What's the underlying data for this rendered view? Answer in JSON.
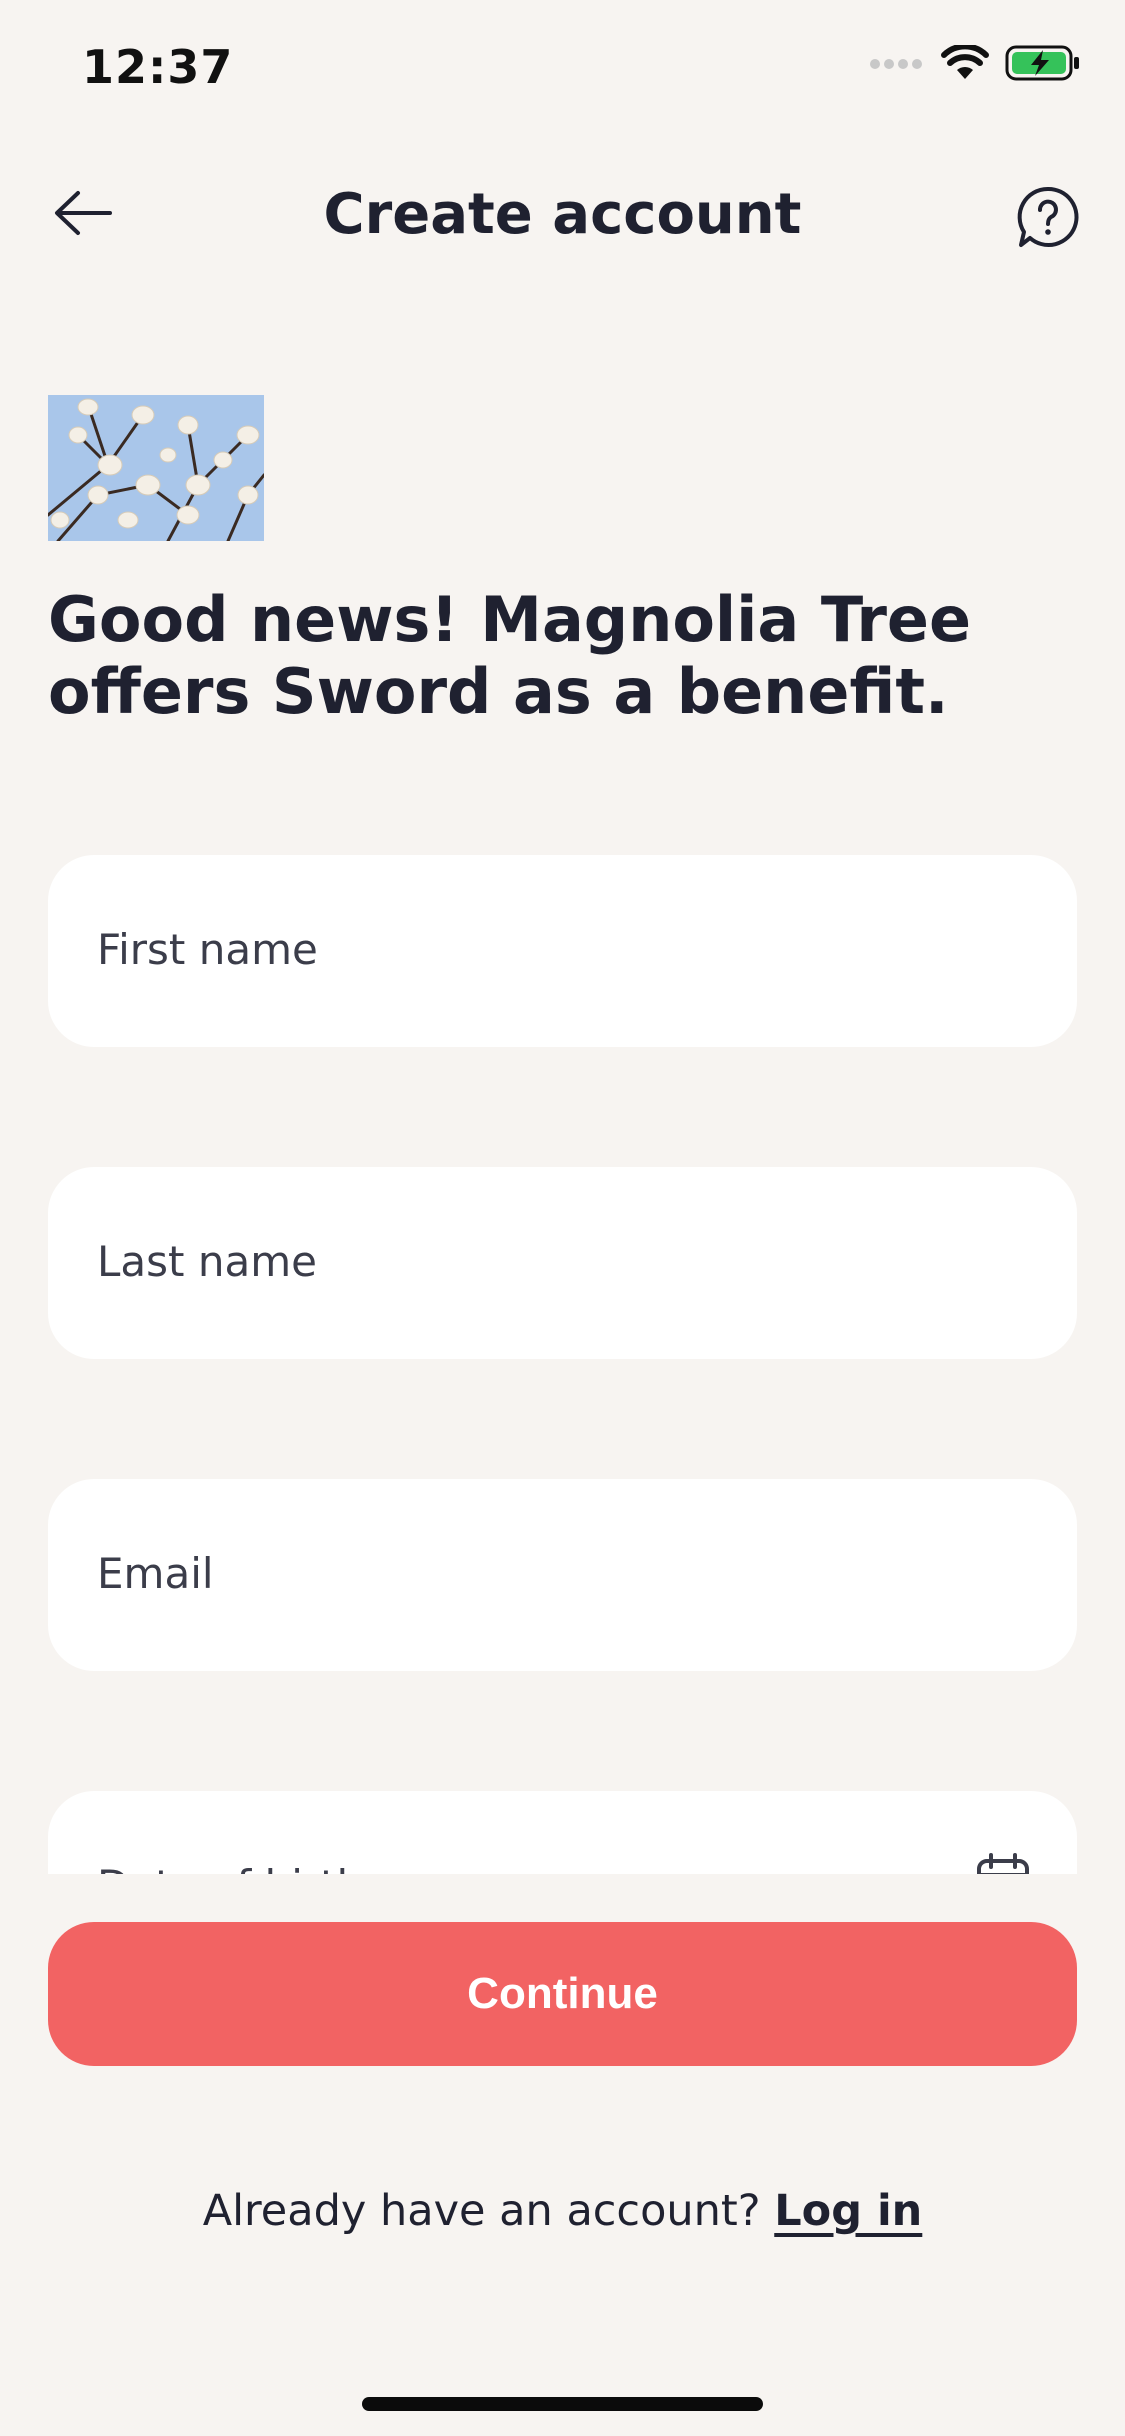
{
  "status_bar": {
    "time": "12:37",
    "icons": [
      "signal-dots-icon",
      "wifi-icon",
      "battery-charging-icon"
    ]
  },
  "header": {
    "title": "Create account",
    "back_icon": "arrow-left-icon",
    "help_icon": "question-bubble-icon"
  },
  "hero": {
    "image_name": "magnolia-tree-image",
    "headline": "Good news! Magnolia Tree offers Sword as a benefit."
  },
  "form": {
    "fields": [
      {
        "label": "First name"
      },
      {
        "label": "Last name"
      },
      {
        "label": "Email"
      },
      {
        "label": "Date of birth",
        "icon": "calendar-icon"
      }
    ]
  },
  "actions": {
    "continue_label": "Continue",
    "login_prompt": "Already have an account?",
    "login_link": "Log in"
  },
  "colors": {
    "background": "#f7f4f1",
    "primary": "#f26363",
    "text": "#1f2130",
    "field_bg": "#ffffff"
  }
}
